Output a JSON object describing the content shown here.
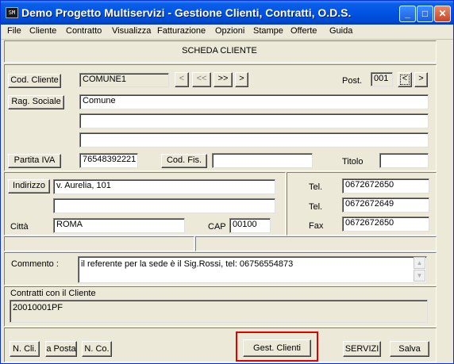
{
  "window": {
    "title": "Demo Progetto Multiservizi - Gestione Clienti, Contratti, O.D.S.",
    "icon_text": "SM",
    "min_symbol": "_",
    "max_symbol": "□",
    "close_symbol": "✕"
  },
  "menu": [
    "File",
    "Cliente",
    "Contratto",
    "Visualizza",
    "Fatturazione",
    "Opzioni",
    "Stampe",
    "Offerte",
    "Guida"
  ],
  "header": {
    "title": "SCHEDA CLIENTE"
  },
  "anagrafica": {
    "cod_cliente_label": "Cod. Cliente",
    "cod_cliente_value": "COMUNE1",
    "nav": [
      "<",
      "<<",
      ">>",
      ">"
    ],
    "post_label": "Post.",
    "post_value": "001",
    "post_next": ">",
    "rag_sociale_label": "Rag. Sociale",
    "rag_sociale_1": "Comune",
    "rag_sociale_2": "",
    "rag_sociale_3": "",
    "partita_iva_label": "Partita IVA",
    "partita_iva_value": "76548392221",
    "cod_fis_label": "Cod. Fis.",
    "cod_fis_value": "",
    "titolo_label": "Titolo",
    "titolo_value": ""
  },
  "indirizzo": {
    "label": "Indirizzo",
    "riga1": "v. Aurelia, 101",
    "riga2": "",
    "citta_label": "Città",
    "citta_value": "ROMA",
    "cap_label": "CAP",
    "cap_value": "00100"
  },
  "contatti": {
    "tel1_label": "Tel.",
    "tel1_value": "0672672650",
    "tel2_label": "Tel.",
    "tel2_value": "0672672649",
    "fax_label": "Fax",
    "fax_value": "0672672650"
  },
  "commento": {
    "label": "Commento :",
    "value": "il referente per la sede è il Sig.Rossi, tel: 06756554873"
  },
  "contratti": {
    "label": "Contratti con il Cliente",
    "value": "20010001PF"
  },
  "footer": {
    "n_cli": "N. Cli.",
    "a_posta": "a Posta",
    "n_co": "N. Co.",
    "gest_clienti": "Gest. Clienti",
    "servizi": "SERVIZI",
    "salva": "Salva"
  }
}
